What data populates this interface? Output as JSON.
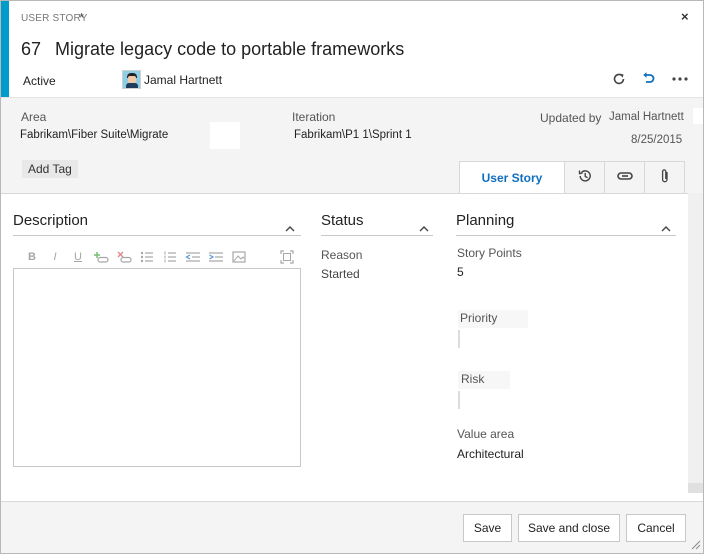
{
  "header": {
    "type_label": "USER STORY",
    "dirty_marker": "*",
    "close_glyph": "×",
    "id": "67",
    "title": "Migrate legacy code to portable frameworks",
    "state": "Active",
    "assigned_to": "Jamal Hartnett",
    "more_glyph": "···",
    "accent_color": "#009ccc"
  },
  "meta": {
    "area_label": "Area",
    "area_value": "Fabrikam\\Fiber Suite\\Migrate",
    "iteration_label": "Iteration",
    "iteration_value": "Fabrikam\\P1 1\\Sprint 1",
    "updated_by_label": "Updated by",
    "updated_by_value": "Jamal Hartnett",
    "updated_date": "8/25/2015",
    "add_tag": "Add Tag"
  },
  "tabs": {
    "user_story": "User Story",
    "icons": [
      "history-icon",
      "links-icon",
      "attachment-icon"
    ],
    "active_color": "#106ebe"
  },
  "description": {
    "title": "Description",
    "toolbar": [
      "B",
      "I",
      "U"
    ],
    "toolbar_icons": [
      "insert-link-icon",
      "remove-link-icon",
      "bullet-list-icon",
      "numbered-list-icon",
      "outdent-icon",
      "indent-icon",
      "insert-image-icon",
      "maximize-icon"
    ]
  },
  "status": {
    "title": "Status",
    "reason_label": "Reason",
    "reason_value": "Started"
  },
  "planning": {
    "title": "Planning",
    "story_points_label": "Story Points",
    "story_points_value": "5",
    "priority_label": "Priority",
    "risk_label": "Risk",
    "value_area_label": "Value area",
    "value_area_value": "Architectural"
  },
  "footer": {
    "save": "Save",
    "save_close": "Save and close",
    "cancel": "Cancel"
  }
}
